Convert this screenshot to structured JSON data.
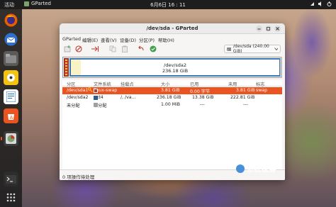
{
  "topbar": {
    "activities": "活动",
    "app": "GParted",
    "clock": "6月6日 16 : 11"
  },
  "dock": {
    "items": [
      "firefox-icon",
      "thunderbird-icon",
      "files-icon",
      "rhythmbox-icon",
      "writer-icon",
      "software-icon",
      "gparted-icon",
      "terminal-icon",
      "app-grid-icon"
    ]
  },
  "window": {
    "title": "/dev/sda - GParted",
    "menu": [
      "GParted",
      "编辑(E)",
      "查看(V)",
      "设备(D)",
      "分区(P)",
      "帮助(H)"
    ],
    "device_selector": "/dev/sda (240.00 GiB)",
    "diskmap": {
      "partition": "/dev/sda2",
      "size": "236.18 GiB"
    },
    "columns": [
      "分区",
      "文件系统",
      "挂载点",
      "大小",
      "已用",
      "未用",
      "标志"
    ],
    "rows": [
      {
        "partition": "/dev/sda1",
        "fs": "linux-swap",
        "mount": "",
        "size": "3.81 GiB",
        "used": "0.00 字节",
        "unused": "3.81 GiB",
        "flags": "swap",
        "fs_color": "#c0392b",
        "selected": true
      },
      {
        "partition": "/dev/sda2",
        "fs": "ext4",
        "mount": "/, /va...",
        "size": "236.18 GiB",
        "used": "13.38 GiB",
        "unused": "222.81 GiB",
        "flags": "",
        "fs_color": "#2c5f8a",
        "selected": false
      },
      {
        "partition": "未分配",
        "fs": "未分配",
        "mount": "",
        "size": "1.00 MiB",
        "used": "---",
        "unused": "---",
        "flags": "",
        "fs_color": "#a0a0a0",
        "selected": false
      }
    ],
    "status": "0 项操作待处理"
  },
  "watermark": "系统极客",
  "colors": {
    "accent": "#e95420",
    "ext4": "#2c5f8a",
    "swap": "#c0392b"
  }
}
